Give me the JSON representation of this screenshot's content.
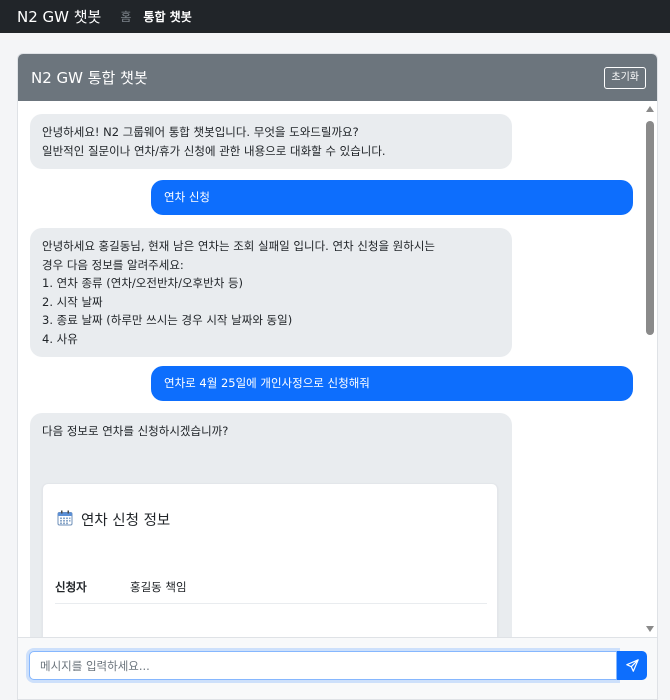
{
  "navbar": {
    "brand": "N2 GW 챗봇",
    "home_label": "홈",
    "current_label": "통합 챗봇"
  },
  "card": {
    "title": "N2 GW 통합 챗봇",
    "reset_label": "초기화"
  },
  "messages": [
    {
      "role": "bot",
      "lines": [
        "안녕하세요! N2 그룹웨어 통합 챗봇입니다. 무엇을 도와드릴까요?",
        "일반적인 질문이나 연차/휴가 신청에 관한 내용으로 대화할 수 있습니다."
      ]
    },
    {
      "role": "user",
      "lines": [
        "연차 신청"
      ]
    },
    {
      "role": "bot",
      "lines": [
        "안녕하세요 홍길동님, 현재 남은 연차는 조회 실패일 입니다. 연차 신청을 원하시는",
        "경우 다음 정보를 알려주세요:",
        "1. 연차 종류 (연차/오전반차/오후반차 등)",
        "2. 시작 날짜",
        "3. 종료 날짜 (하루만 쓰시는 경우 시작 날짜와 동일)",
        "4. 사유"
      ]
    },
    {
      "role": "user",
      "lines": [
        "연차로 4월 25일에 개인사정으로 신청해줘"
      ]
    },
    {
      "role": "bot",
      "lines": [
        "다음 정보로 연차를 신청하시겠습니까?"
      ]
    }
  ],
  "leave_info": {
    "icon": "calendar-icon",
    "title": "연차 신청 정보",
    "rows": [
      {
        "label": "신청자",
        "value": "홍길동 책임"
      }
    ]
  },
  "input": {
    "placeholder": "메시지를 입력하세요...",
    "value": ""
  },
  "colors": {
    "navbar_bg": "#212529",
    "header_bg": "#6c757d",
    "user_bubble": "#0d6efd",
    "bot_bubble": "#e9ecef"
  }
}
